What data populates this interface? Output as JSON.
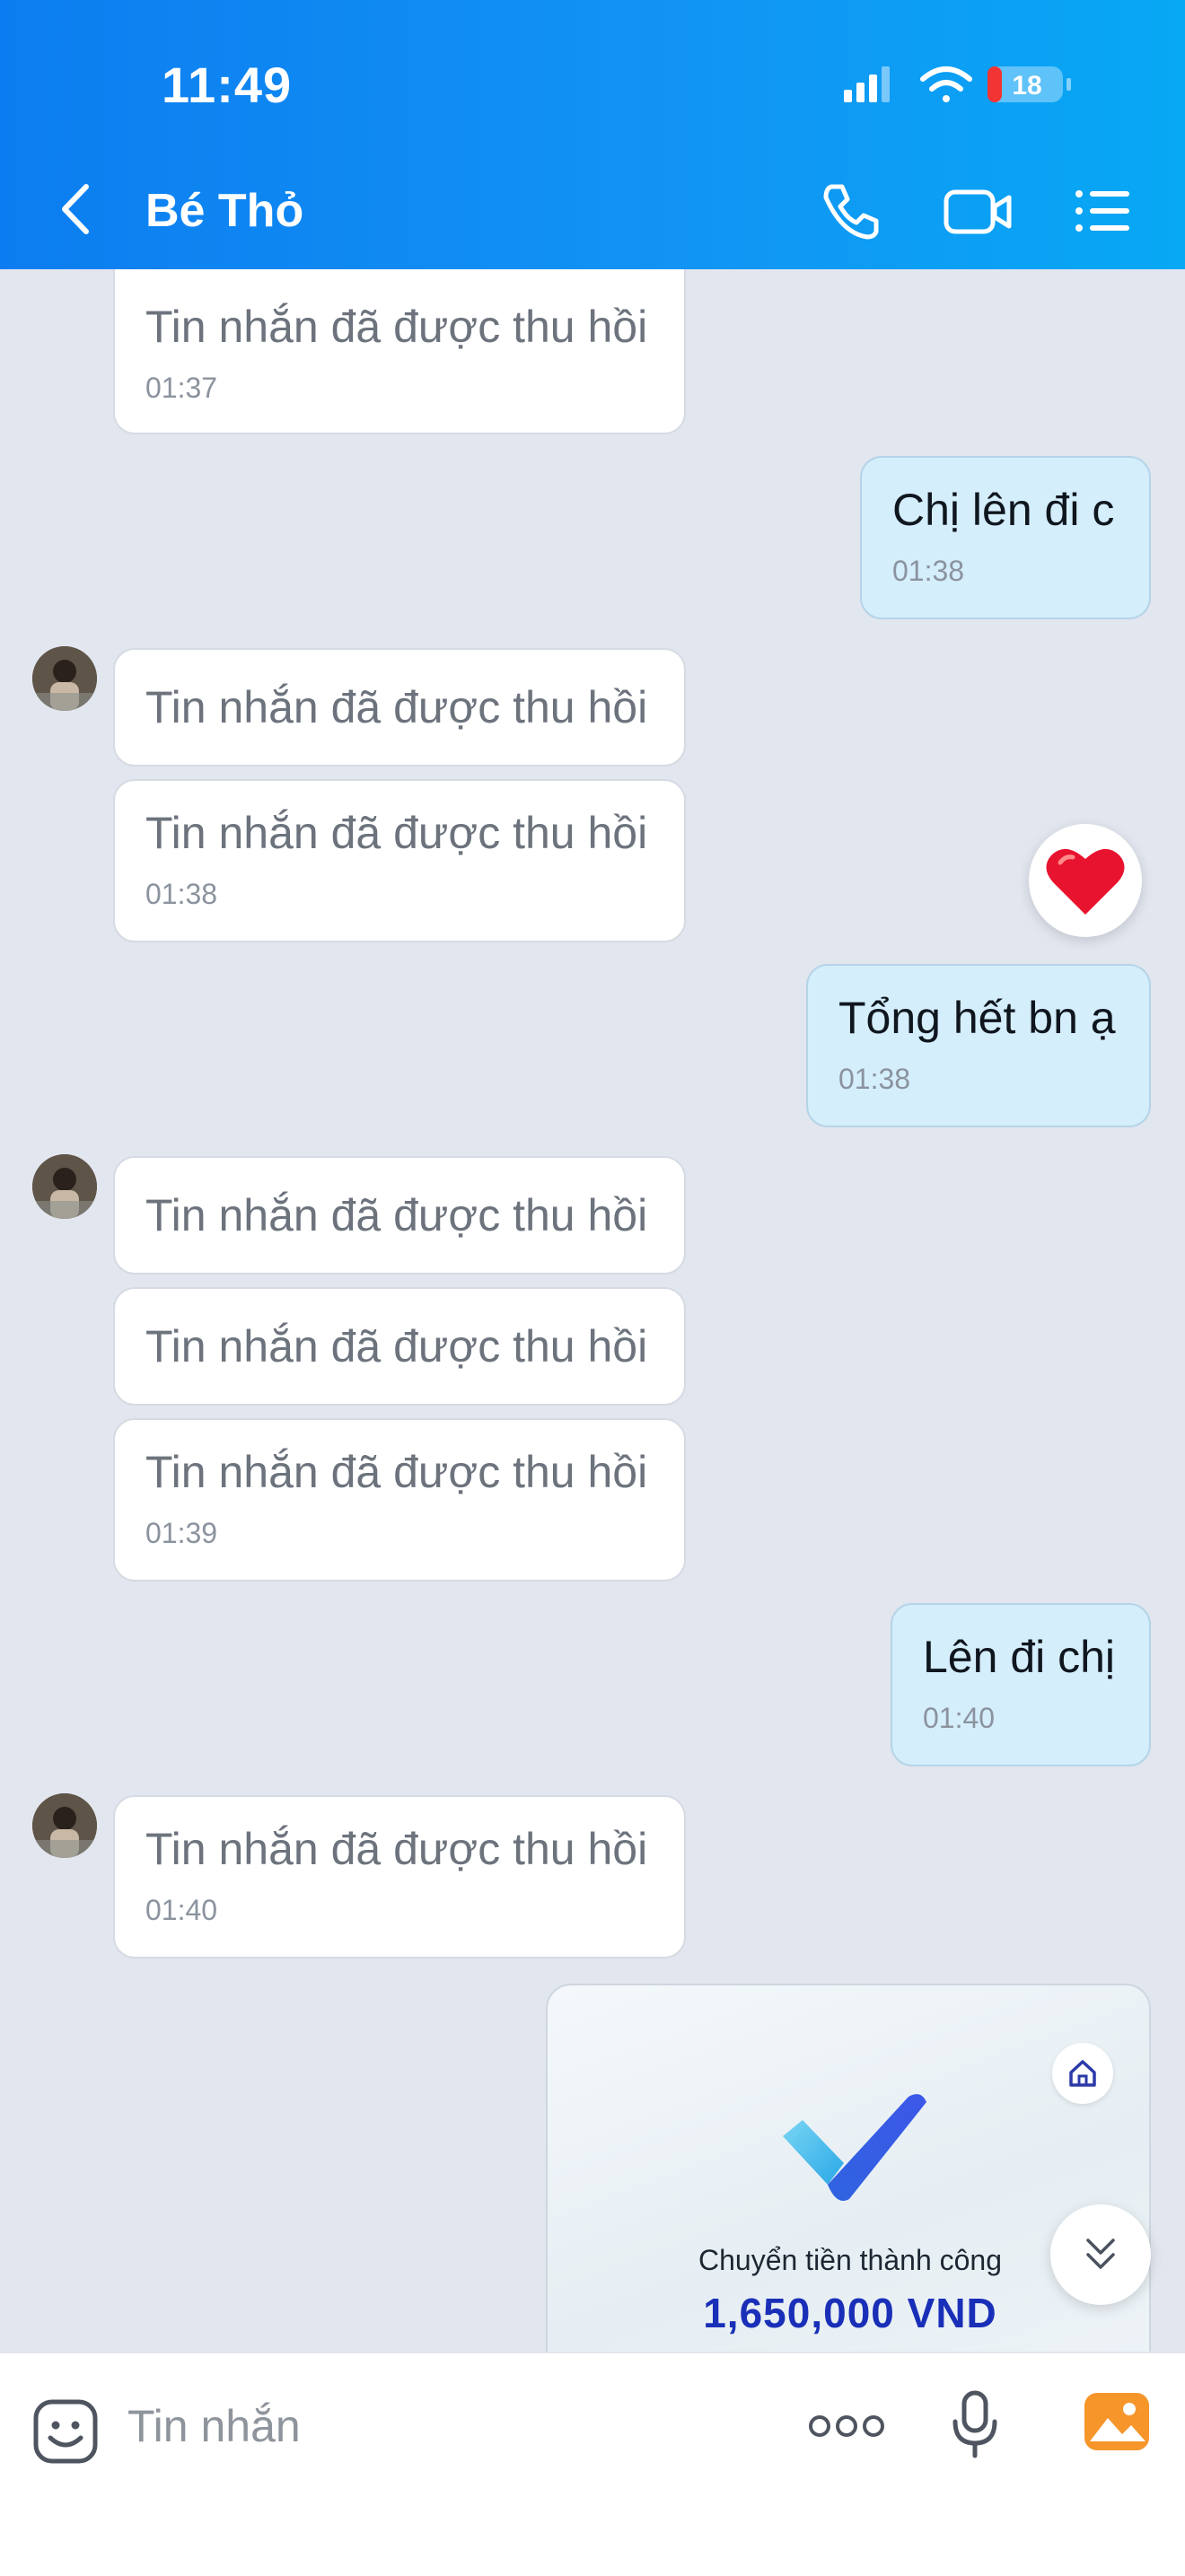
{
  "status_bar": {
    "time": "11:49",
    "battery": "18"
  },
  "header": {
    "title": "Bé Thỏ"
  },
  "messages": [
    {
      "text": "Tin nhắn đã được thu hồi",
      "time": "01:37"
    },
    {
      "text": "Chị lên đi c",
      "time": "01:38"
    },
    {
      "text": "Tin nhắn đã được thu hồi"
    },
    {
      "text": "Tin nhắn đã được thu hồi",
      "time": "01:38"
    },
    {
      "text": "Tổng hết bn ạ",
      "time": "01:38"
    },
    {
      "text": "Tin nhắn đã được thu hồi"
    },
    {
      "text": "Tin nhắn đã được thu hồi"
    },
    {
      "text": "Tin nhắn đã được thu hồi",
      "time": "01:39"
    },
    {
      "text": "Lên đi chị",
      "time": "01:40"
    },
    {
      "text": "Tin nhắn đã được thu hồi",
      "time": "01:40"
    }
  ],
  "reaction": {
    "icon": "red-heart"
  },
  "transfer_card": {
    "title": "Chuyển tiền thành công",
    "amount": "1,650,000 VND"
  },
  "composer": {
    "placeholder": "Tin nhắn"
  },
  "colors": {
    "header": "#0c7df0",
    "outgoing_bubble": "#d4eefc",
    "amount": "#1a2fb8",
    "heart": "#e8132f"
  }
}
